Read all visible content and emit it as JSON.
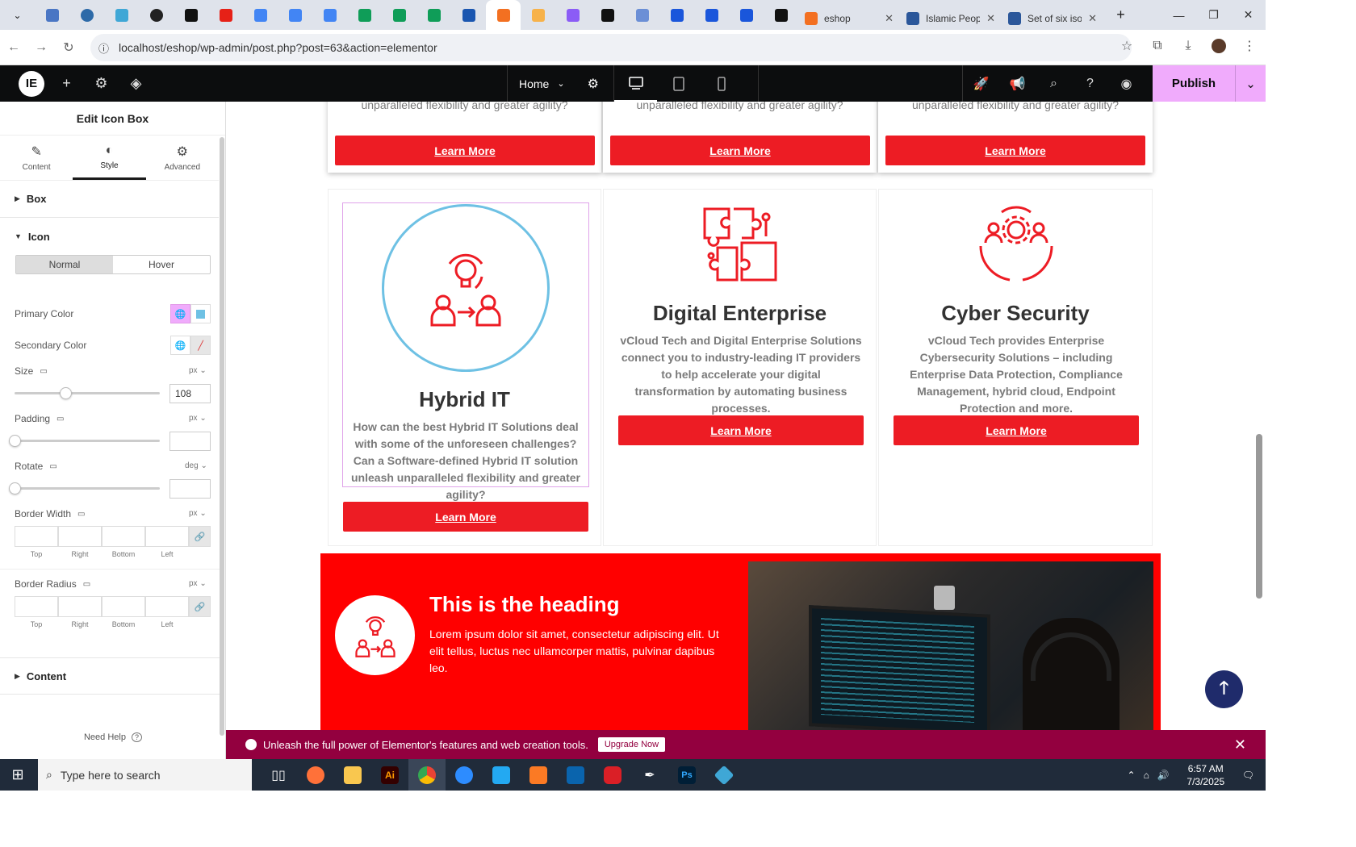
{
  "browser": {
    "tabs": [
      {
        "label": "eshop",
        "color": "#f37021"
      },
      {
        "label": "Islamic Peop",
        "color": "#2b579a"
      },
      {
        "label": "Set of six iso",
        "color": "#2b579a"
      }
    ],
    "url": "localhost/eshop/wp-admin/post.php?post=63&action=elementor"
  },
  "editor": {
    "page_selector": "Home",
    "publish_label": "Publish"
  },
  "panel": {
    "title": "Edit Icon Box",
    "tabs": [
      {
        "label": "Content",
        "icon": "pencil-icon"
      },
      {
        "label": "Style",
        "icon": "half-circle-icon"
      },
      {
        "label": "Advanced",
        "icon": "gear-icon"
      }
    ],
    "sections": {
      "box": "Box",
      "icon": "Icon",
      "content": "Content"
    },
    "state_toggle": {
      "normal": "Normal",
      "hover": "Hover"
    },
    "primary_color_label": "Primary Color",
    "primary_color_value": "#6ec1e4",
    "secondary_color_label": "Secondary Color",
    "size_label": "Size",
    "size_unit": "px",
    "size_value": "108",
    "size_slider_fraction": 0.35,
    "padding_label": "Padding",
    "padding_unit": "px",
    "rotate_label": "Rotate",
    "rotate_unit": "deg",
    "border_width_label": "Border Width",
    "border_width_unit": "px",
    "border_radius_label": "Border Radius",
    "border_radius_unit": "px",
    "dim_labels": [
      "Top",
      "Right",
      "Bottom",
      "Left"
    ],
    "need_help": "Need Help"
  },
  "canvas": {
    "top_cards_text": "unparalleled flexibility and greater agility?",
    "learn_more": "Learn More",
    "cards": [
      {
        "title": "Hybrid IT",
        "desc": "How can the best Hybrid IT Solutions deal with some of the unforeseen challenges? Can a Software-defined Hybrid IT solution unleash unparalleled flexibility and greater agility?"
      },
      {
        "title": "Digital Enterprise",
        "desc": "vCloud Tech and Digital Enterprise Solutions connect you to industry-leading IT providers to help accelerate your digital transformation by automating business processes."
      },
      {
        "title": "Cyber Security",
        "desc": "vCloud Tech provides Enterprise Cybersecurity Solutions – including Enterprise Data Protection, Compliance Management, hybrid cloud, Endpoint Protection and more."
      }
    ],
    "banner": {
      "heading": "This is the heading",
      "text": "Lorem ipsum dolor sit amet, consectetur adipiscing elit. Ut elit tellus, luctus nec ullamcorper mattis, pulvinar dapibus leo."
    },
    "accent_color": "#ed1c24"
  },
  "promo": {
    "text": "Unleash the full power of Elementor's features and web creation tools.",
    "button": "Upgrade Now"
  },
  "taskbar": {
    "search_placeholder": "Type here to search",
    "time": "6:57 AM",
    "date": "7/3/2025"
  }
}
